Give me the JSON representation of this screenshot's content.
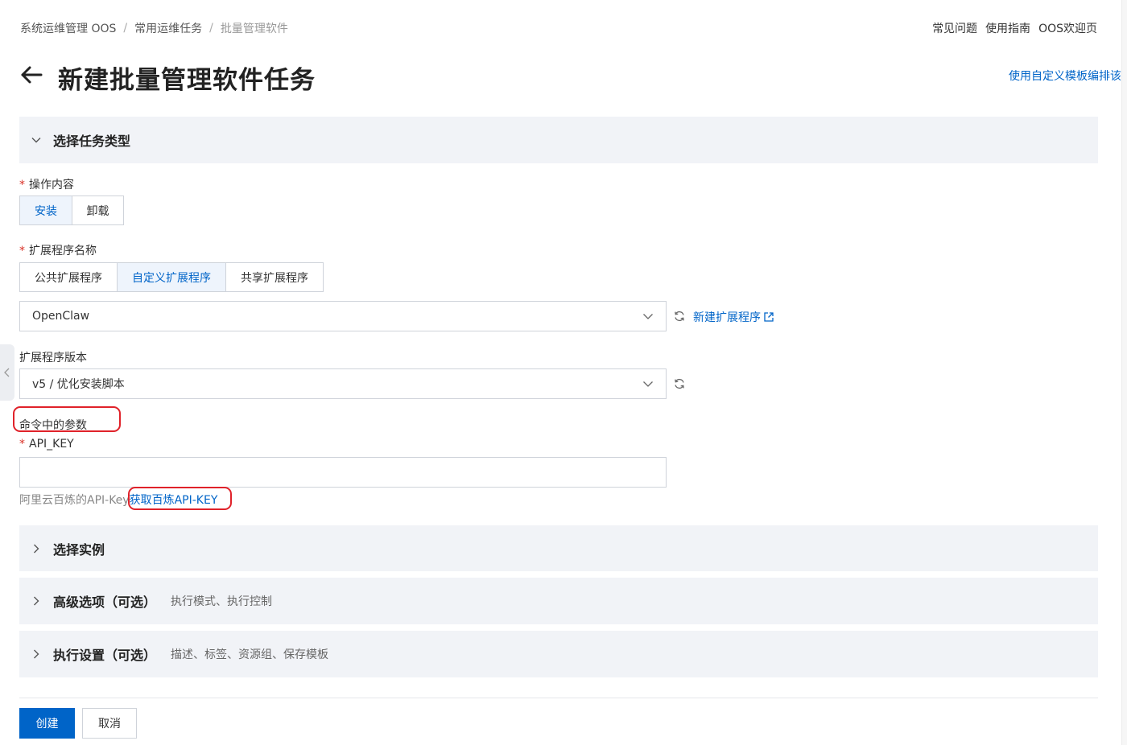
{
  "breadcrumb": [
    "系统运维管理 OOS",
    "常用运维任务",
    "批量管理软件"
  ],
  "top_links": [
    "常见问题",
    "使用指南",
    "OOS欢迎页"
  ],
  "page_title": "新建批量管理软件任务",
  "template_link": "使用自定义模板编排该",
  "sections": {
    "task_type": {
      "title": "选择任务类型",
      "expanded": true
    },
    "instances": {
      "title": "选择实例",
      "expanded": false
    },
    "advanced": {
      "title": "高级选项（可选）",
      "desc": "执行模式、执行控制",
      "expanded": false
    },
    "exec_settings": {
      "title": "执行设置（可选）",
      "desc": "描述、标签、资源组、保存模板",
      "expanded": false
    }
  },
  "operation": {
    "label": "操作内容",
    "required": "*",
    "options": [
      "安装",
      "卸载"
    ],
    "selected": "安装"
  },
  "extension": {
    "label": "扩展程序名称",
    "required": "*",
    "options": [
      "公共扩展程序",
      "自定义扩展程序",
      "共享扩展程序"
    ],
    "selected": "自定义扩展程序",
    "value": "OpenClaw",
    "new_link": "新建扩展程序"
  },
  "version": {
    "label": "扩展程序版本",
    "value": "v5 / 优化安装脚本"
  },
  "command_params": {
    "label": "命令中的参数"
  },
  "api_key": {
    "label": "API_KEY",
    "required": "*",
    "value": "",
    "hint": "阿里云百炼的API-Key",
    "hint_link": "获取百炼API-KEY"
  },
  "buttons": {
    "create": "创建",
    "cancel": "取消"
  },
  "colors": {
    "accent": "#0064c8",
    "required": "#d93026",
    "annotation": "#e0222a",
    "section_bg": "#f1f3f7"
  }
}
